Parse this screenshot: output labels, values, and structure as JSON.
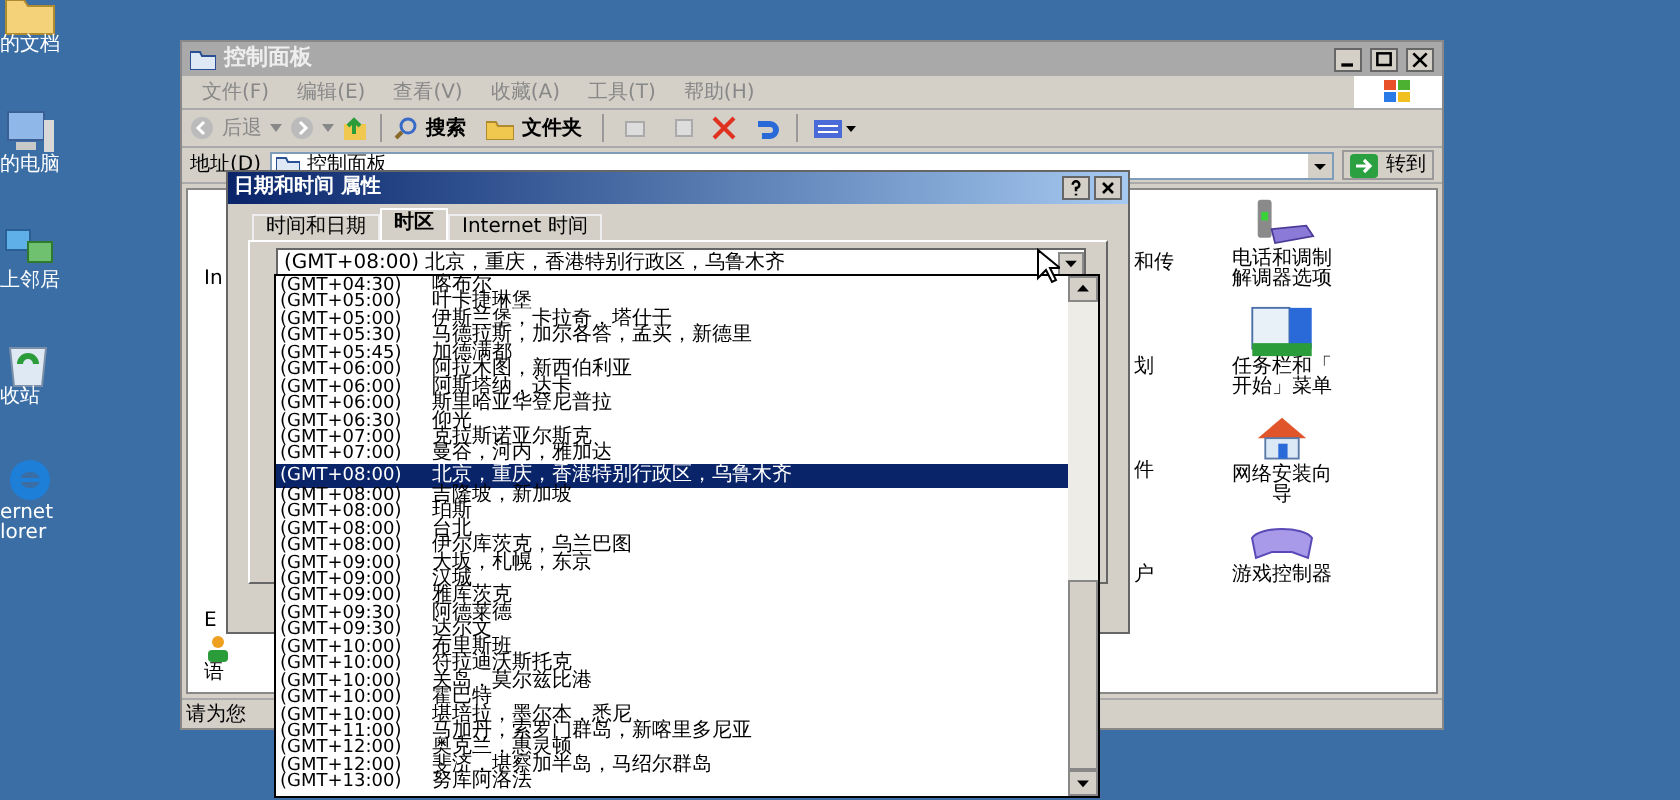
{
  "desktop_icons": [
    {
      "kind": "documents",
      "lines": [
        "的文档"
      ]
    },
    {
      "kind": "computer",
      "lines": [
        "的电脑"
      ]
    },
    {
      "kind": "network",
      "lines": [
        "上邻居"
      ]
    },
    {
      "kind": "recycle",
      "lines": [
        "收站"
      ]
    },
    {
      "kind": "browser",
      "lines": [
        "ernet",
        "lorer"
      ]
    }
  ],
  "explorer": {
    "title": "控制面板",
    "menu": [
      "文件(F)",
      "编辑(E)",
      "查看(V)",
      "收藏(A)",
      "工具(T)",
      "帮助(H)"
    ],
    "toolbar": {
      "back": "后退",
      "search": "搜索",
      "folders": "文件夹"
    },
    "address": {
      "label": "地址(D)",
      "value": "控制面板",
      "go": "转到"
    },
    "left_column": [
      "In",
      "E",
      "语"
    ],
    "middle_column": [
      "和传",
      "划",
      "件",
      "户"
    ],
    "right_column": [
      {
        "kind": "phone",
        "lines": [
          "电话和调制",
          "解调器选项"
        ]
      },
      {
        "kind": "taskbar",
        "lines": [
          "任务栏和「",
          "开始」菜单"
        ]
      },
      {
        "kind": "network-wizard",
        "lines": [
          "网络安装向",
          "导"
        ]
      },
      {
        "kind": "gamepad",
        "lines": [
          "游戏控制器"
        ]
      }
    ],
    "status_bar": "请为您"
  },
  "dialog": {
    "title": "日期和时间 属性",
    "tabs": [
      {
        "label": "时间和日期",
        "selected": false
      },
      {
        "label": "时区",
        "selected": true
      },
      {
        "label": "Internet 时间",
        "selected": false
      }
    ],
    "timezone": {
      "value": "(GMT+08:00) 北京，重庆，香港特别行政区，乌鲁木齐",
      "options": [
        {
          "offset": "(GMT+04:30)",
          "name": "喀布尔",
          "selected": false
        },
        {
          "offset": "(GMT+05:00)",
          "name": "叶卡捷琳堡",
          "selected": false
        },
        {
          "offset": "(GMT+05:00)",
          "name": "伊斯兰堡，卡拉奇，塔什干",
          "selected": false
        },
        {
          "offset": "(GMT+05:30)",
          "name": "马德拉斯，加尔各答，孟买，新德里",
          "selected": false
        },
        {
          "offset": "(GMT+05:45)",
          "name": "加德满都",
          "selected": false
        },
        {
          "offset": "(GMT+06:00)",
          "name": "阿拉木图，新西伯利亚",
          "selected": false
        },
        {
          "offset": "(GMT+06:00)",
          "name": "阿斯塔纳，达卡",
          "selected": false
        },
        {
          "offset": "(GMT+06:00)",
          "name": "斯里哈亚华登尼普拉",
          "selected": false
        },
        {
          "offset": "(GMT+06:30)",
          "name": "仰光",
          "selected": false
        },
        {
          "offset": "(GMT+07:00)",
          "name": "克拉斯诺亚尔斯克",
          "selected": false
        },
        {
          "offset": "(GMT+07:00)",
          "name": "曼谷，河内，雅加达",
          "selected": false
        },
        {
          "offset": "(GMT+08:00)",
          "name": "北京，重庆，香港特别行政区，乌鲁木齐",
          "selected": true
        },
        {
          "offset": "(GMT+08:00)",
          "name": "吉隆坡，新加坡",
          "selected": false
        },
        {
          "offset": "(GMT+08:00)",
          "name": "珀斯",
          "selected": false
        },
        {
          "offset": "(GMT+08:00)",
          "name": "台北",
          "selected": false
        },
        {
          "offset": "(GMT+08:00)",
          "name": "伊尔库茨克，乌兰巴图",
          "selected": false
        },
        {
          "offset": "(GMT+09:00)",
          "name": "大坂，札幌，东京",
          "selected": false
        },
        {
          "offset": "(GMT+09:00)",
          "name": "汉城",
          "selected": false
        },
        {
          "offset": "(GMT+09:00)",
          "name": "雅库茨克",
          "selected": false
        },
        {
          "offset": "(GMT+09:30)",
          "name": "阿德莱德",
          "selected": false
        },
        {
          "offset": "(GMT+09:30)",
          "name": "达尔文",
          "selected": false
        },
        {
          "offset": "(GMT+10:00)",
          "name": "布里斯班",
          "selected": false
        },
        {
          "offset": "(GMT+10:00)",
          "name": "符拉迪沃斯托克",
          "selected": false
        },
        {
          "offset": "(GMT+10:00)",
          "name": "关岛，莫尔兹比港",
          "selected": false
        },
        {
          "offset": "(GMT+10:00)",
          "name": "霍巴特",
          "selected": false
        },
        {
          "offset": "(GMT+10:00)",
          "name": "堪培拉，墨尔本，悉尼",
          "selected": false
        },
        {
          "offset": "(GMT+11:00)",
          "name": "马加丹，索罗门群岛，新喀里多尼亚",
          "selected": false
        },
        {
          "offset": "(GMT+12:00)",
          "name": "奥克兰，惠灵顿",
          "selected": false
        },
        {
          "offset": "(GMT+12:00)",
          "name": "斐济，堪察加半岛，马绍尔群岛",
          "selected": false
        },
        {
          "offset": "(GMT+13:00)",
          "name": "努库阿洛法",
          "selected": false
        }
      ]
    }
  }
}
